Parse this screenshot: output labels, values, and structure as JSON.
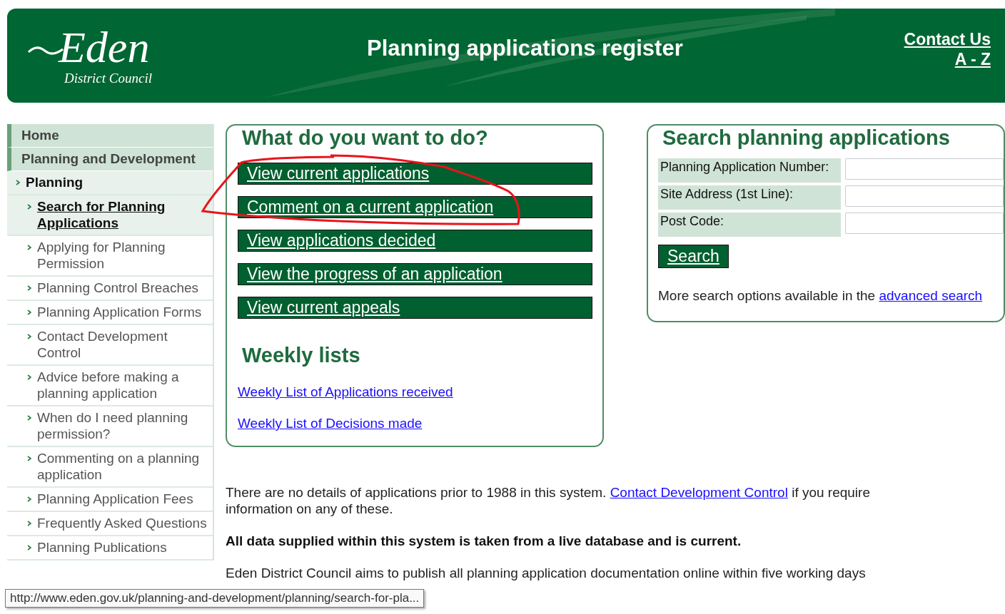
{
  "header": {
    "logo": {
      "name": "Eden",
      "subtitle": "District Council"
    },
    "title": "Planning applications register",
    "links": [
      "Contact Us",
      "A - Z"
    ]
  },
  "sidebar": {
    "items": [
      {
        "label": "Home",
        "selected": false
      },
      {
        "label": "Planning and Development",
        "selected": false,
        "children": [
          {
            "label": "Planning",
            "selected": false,
            "children": [
              {
                "label": "Search for Planning Applications",
                "selected": true
              },
              {
                "label": "Applying for Planning Permission",
                "selected": false
              },
              {
                "label": "Planning Control Breaches",
                "selected": false
              },
              {
                "label": "Planning Application Forms",
                "selected": false
              },
              {
                "label": "Contact Development Control",
                "selected": false
              },
              {
                "label": "Advice before making a planning application",
                "selected": false
              },
              {
                "label": "When do I need planning permission?",
                "selected": false
              },
              {
                "label": "Commenting on a planning application",
                "selected": false
              },
              {
                "label": "Planning Application Fees",
                "selected": false
              },
              {
                "label": "Frequently Asked Questions",
                "selected": false
              },
              {
                "label": "Planning Publications",
                "selected": false
              }
            ]
          }
        ]
      }
    ]
  },
  "tasks": {
    "heading": "What do you want to do?",
    "buttons": [
      "View current applications",
      "Comment on a current application",
      "View applications decided",
      "View the progress of an application",
      "View current appeals"
    ],
    "annotation": {
      "kind": "freehand-loop"
    },
    "weekly_heading": "Weekly lists",
    "weekly_links": [
      "Weekly List of Applications received",
      "Weekly List of Decisions made"
    ]
  },
  "search": {
    "heading": "Search planning applications",
    "fields": [
      {
        "label": "Planning Application Number:"
      },
      {
        "label": "Site Address (1st Line):"
      },
      {
        "label": "Post Code:"
      }
    ],
    "button": "Search",
    "note": "More search options available in the",
    "note_link": "advanced search"
  },
  "notes": [
    {
      "kind": "linked",
      "before": "There are no details of applications prior to 1988 in this system.",
      "link": "Contact Development Control",
      "after": "if you require information on any of these."
    },
    {
      "kind": "bold",
      "text": "All data supplied within this system is taken from a live database and is current."
    },
    {
      "kind": "plain",
      "text": "Eden District Council aims to publish all planning application documentation online within five working days"
    }
  ],
  "status_tooltip": "http://www.eden.gov.uk/planning-and-development/planning/search-for-pla..."
}
